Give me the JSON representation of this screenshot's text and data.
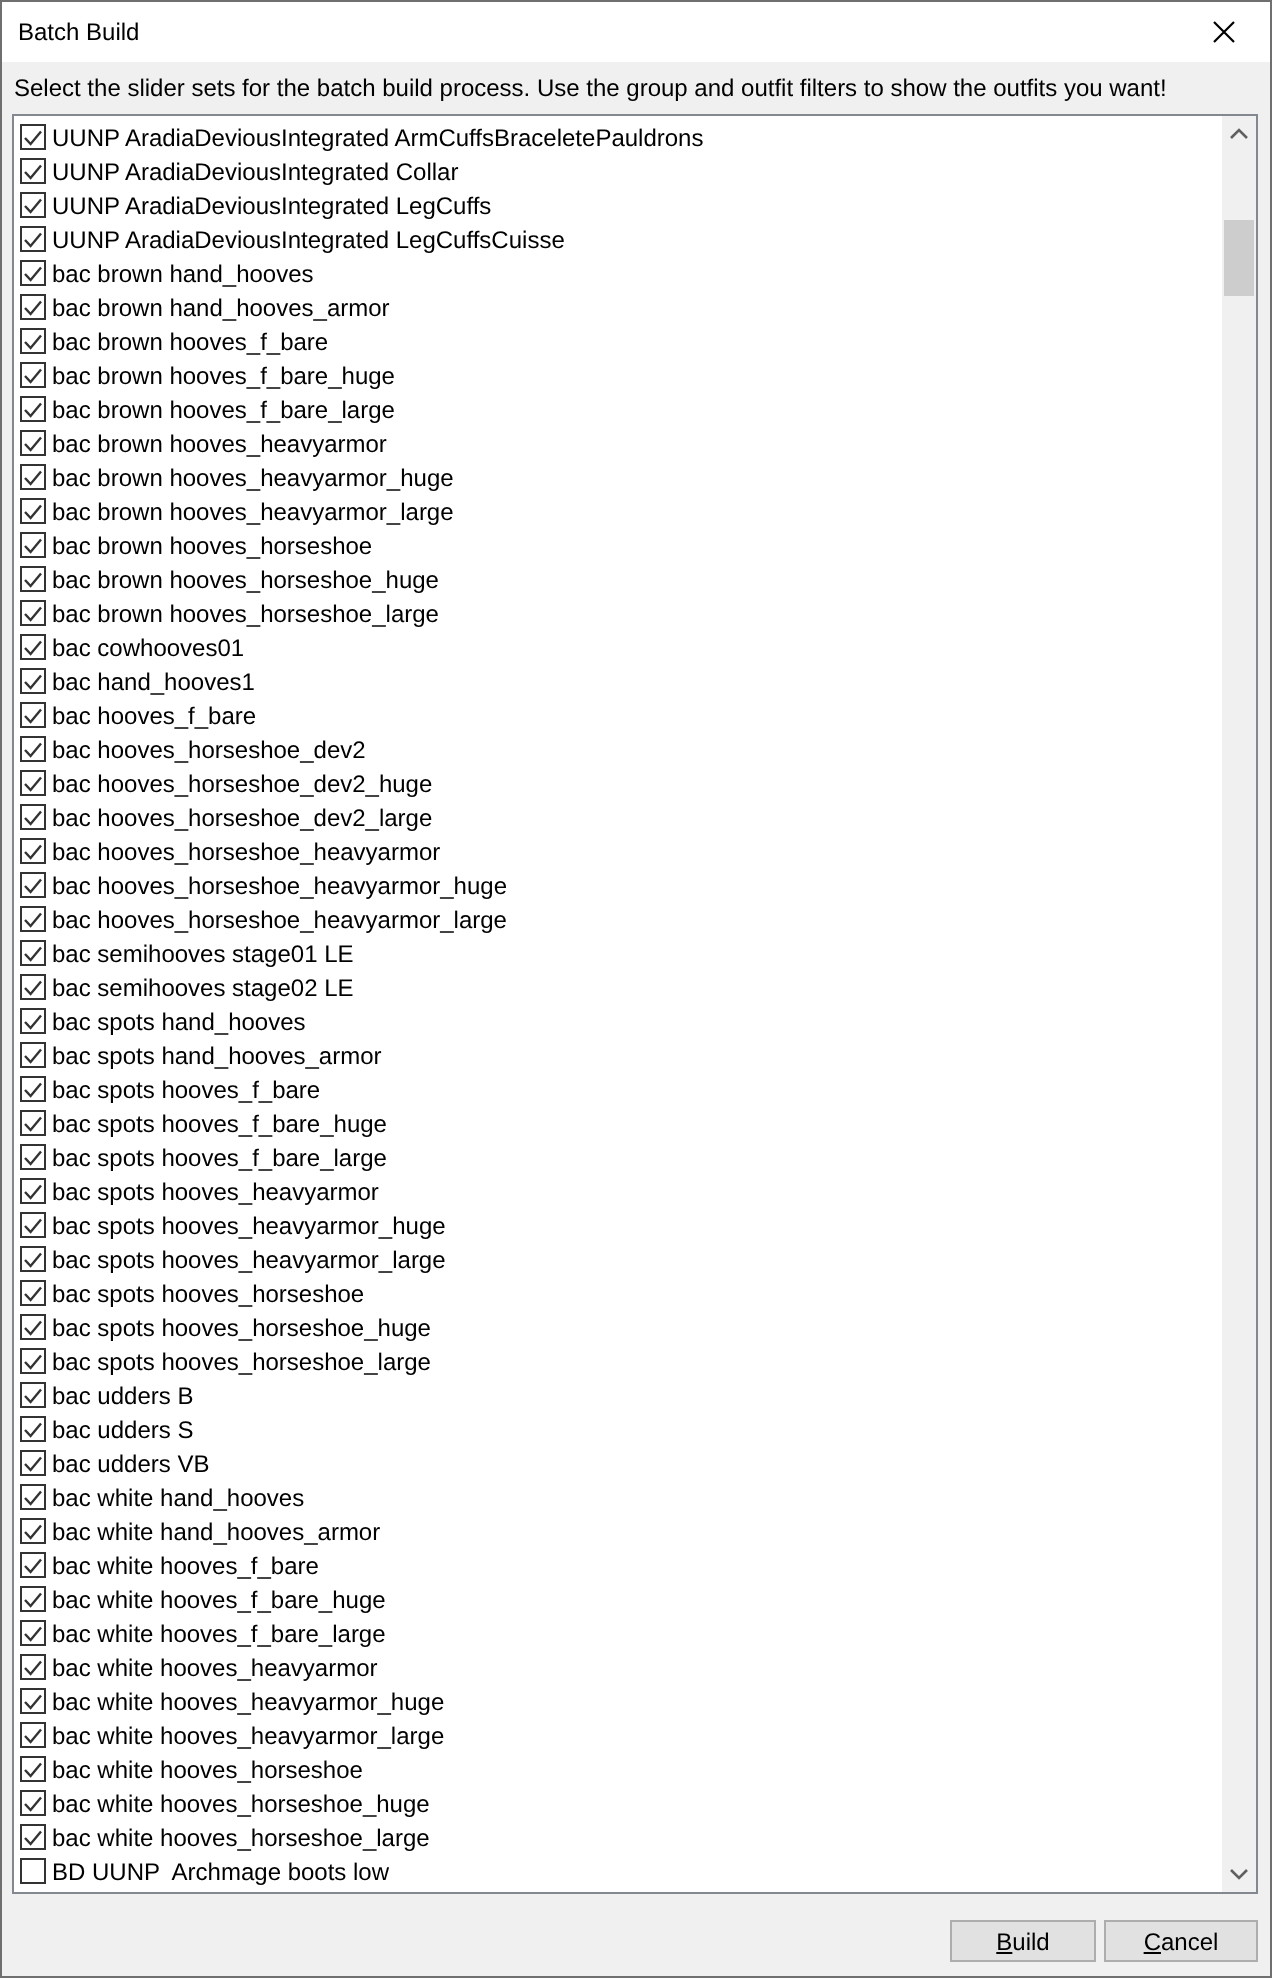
{
  "window": {
    "title": "Batch Build"
  },
  "instructions": "Select the slider sets for the batch build process. Use the group and outfit filters to show the outfits you want!",
  "slider_sets": [
    {
      "label": "UUNP AradiaDeviousIntegrated ArmCuffsBraceletePauldrons",
      "checked": true
    },
    {
      "label": "UUNP AradiaDeviousIntegrated Collar",
      "checked": true
    },
    {
      "label": "UUNP AradiaDeviousIntegrated LegCuffs",
      "checked": true
    },
    {
      "label": "UUNP AradiaDeviousIntegrated LegCuffsCuisse",
      "checked": true
    },
    {
      "label": "bac brown hand_hooves",
      "checked": true
    },
    {
      "label": "bac brown hand_hooves_armor",
      "checked": true
    },
    {
      "label": "bac brown hooves_f_bare",
      "checked": true
    },
    {
      "label": "bac brown hooves_f_bare_huge",
      "checked": true
    },
    {
      "label": "bac brown hooves_f_bare_large",
      "checked": true
    },
    {
      "label": "bac brown hooves_heavyarmor",
      "checked": true
    },
    {
      "label": "bac brown hooves_heavyarmor_huge",
      "checked": true
    },
    {
      "label": "bac brown hooves_heavyarmor_large",
      "checked": true
    },
    {
      "label": "bac brown hooves_horseshoe",
      "checked": true
    },
    {
      "label": "bac brown hooves_horseshoe_huge",
      "checked": true
    },
    {
      "label": "bac brown hooves_horseshoe_large",
      "checked": true
    },
    {
      "label": "bac cowhooves01",
      "checked": true
    },
    {
      "label": "bac hand_hooves1",
      "checked": true
    },
    {
      "label": "bac hooves_f_bare",
      "checked": true
    },
    {
      "label": "bac hooves_horseshoe_dev2",
      "checked": true
    },
    {
      "label": "bac hooves_horseshoe_dev2_huge",
      "checked": true
    },
    {
      "label": "bac hooves_horseshoe_dev2_large",
      "checked": true
    },
    {
      "label": "bac hooves_horseshoe_heavyarmor",
      "checked": true
    },
    {
      "label": "bac hooves_horseshoe_heavyarmor_huge",
      "checked": true
    },
    {
      "label": "bac hooves_horseshoe_heavyarmor_large",
      "checked": true
    },
    {
      "label": "bac semihooves stage01 LE",
      "checked": true
    },
    {
      "label": "bac semihooves stage02 LE",
      "checked": true
    },
    {
      "label": "bac spots hand_hooves",
      "checked": true
    },
    {
      "label": "bac spots hand_hooves_armor",
      "checked": true
    },
    {
      "label": "bac spots hooves_f_bare",
      "checked": true
    },
    {
      "label": "bac spots hooves_f_bare_huge",
      "checked": true
    },
    {
      "label": "bac spots hooves_f_bare_large",
      "checked": true
    },
    {
      "label": "bac spots hooves_heavyarmor",
      "checked": true
    },
    {
      "label": "bac spots hooves_heavyarmor_huge",
      "checked": true
    },
    {
      "label": "bac spots hooves_heavyarmor_large",
      "checked": true
    },
    {
      "label": "bac spots hooves_horseshoe",
      "checked": true
    },
    {
      "label": "bac spots hooves_horseshoe_huge",
      "checked": true
    },
    {
      "label": "bac spots hooves_horseshoe_large",
      "checked": true
    },
    {
      "label": "bac udders B",
      "checked": true
    },
    {
      "label": "bac udders S",
      "checked": true
    },
    {
      "label": "bac udders VB",
      "checked": true
    },
    {
      "label": "bac white hand_hooves",
      "checked": true
    },
    {
      "label": "bac white hand_hooves_armor",
      "checked": true
    },
    {
      "label": "bac white hooves_f_bare",
      "checked": true
    },
    {
      "label": "bac white hooves_f_bare_huge",
      "checked": true
    },
    {
      "label": "bac white hooves_f_bare_large",
      "checked": true
    },
    {
      "label": "bac white hooves_heavyarmor",
      "checked": true
    },
    {
      "label": "bac white hooves_heavyarmor_huge",
      "checked": true
    },
    {
      "label": "bac white hooves_heavyarmor_large",
      "checked": true
    },
    {
      "label": "bac white hooves_horseshoe",
      "checked": true
    },
    {
      "label": "bac white hooves_horseshoe_huge",
      "checked": true
    },
    {
      "label": "bac white hooves_horseshoe_large",
      "checked": true
    },
    {
      "label": "BD UUNP  Archmage boots low",
      "checked": false
    }
  ],
  "buttons": [
    "Build",
    "Cancel"
  ]
}
